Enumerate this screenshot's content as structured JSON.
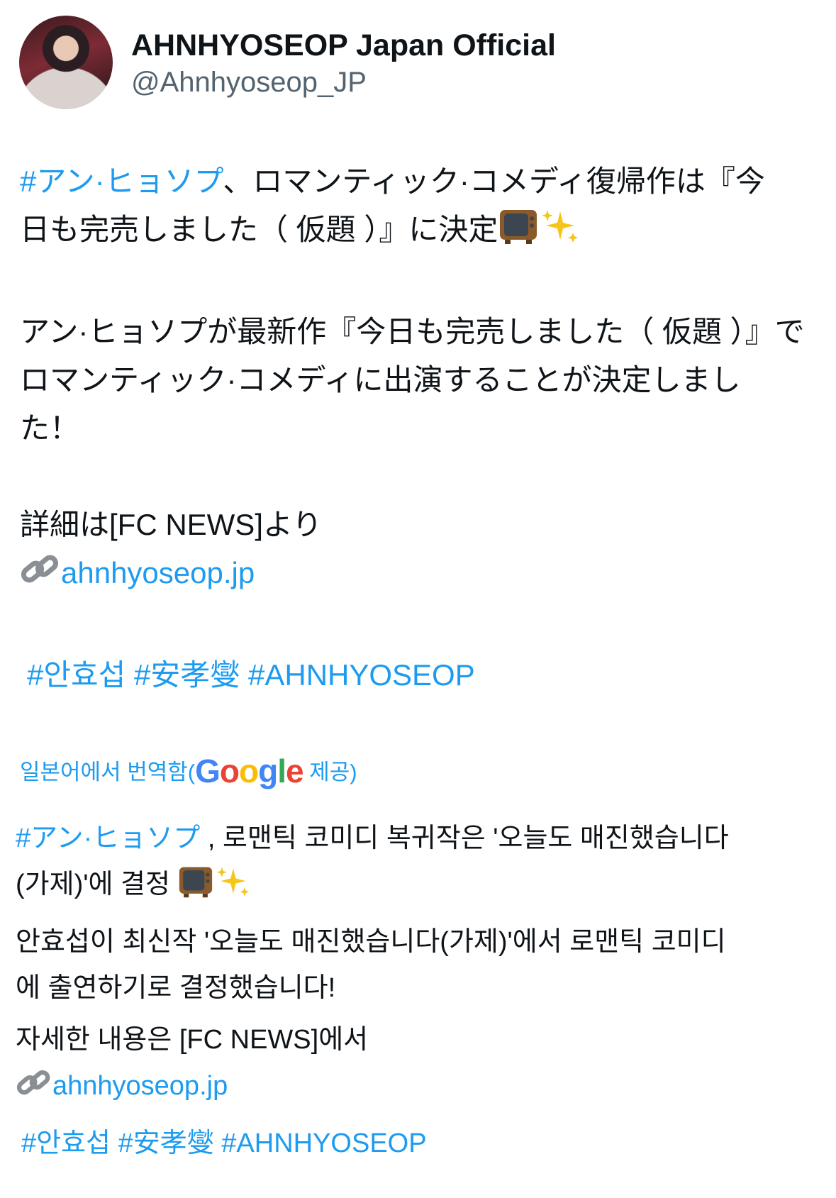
{
  "author": {
    "display_name": "AHNHYOSEOP Japan Official",
    "handle": "@Ahnhyoseop_JP",
    "avatar_icon": "profile-photo"
  },
  "original": {
    "hashtag_lead": "#アン·ヒョソプ",
    "line1_rest": "、ロマンティック·コメディ復帰作は『今",
    "line2": "日も完売しました（ 仮題 ）』に決定",
    "para2_line1": "アン·ヒョソプが最新作『今日も完売しました（ 仮題 ）』で",
    "para2_line2": "ロマンティック·コメディに出演することが決定しまし",
    "para2_line3": "た！",
    "details": "詳細は[FC NEWS]より",
    "link": "ahnhyoseop.jp",
    "tags": [
      "#안효섭",
      "#安孝燮",
      "#AHNHYOSEOP"
    ]
  },
  "translation_note": {
    "prefix": "일본어에서 번역함(",
    "google": [
      "G",
      "o",
      "o",
      "g",
      "l",
      "e"
    ],
    "suffix": " 제공)"
  },
  "translated": {
    "hashtag_lead": "#アン·ヒョソプ",
    "line1_rest": " , 로맨틱 코미디 복귀작은 '오늘도 매진했습니다",
    "line2": "(가제)'에 결정 ",
    "para2_line1": "안효섭이 최신작 '오늘도 매진했습니다(가제)'에서 로맨틱 코미디",
    "para2_line2": "에 출연하기로 결정했습니다!",
    "details": "자세한 내용은 [FC NEWS]에서",
    "link": "ahnhyoseop.jp",
    "tags": [
      "#안효섭",
      "#安孝燮",
      "#AHNHYOSEOP"
    ]
  },
  "icons": {
    "tv": "tv-icon",
    "sparkles": "sparkles-icon",
    "link": "link-icon"
  },
  "colors": {
    "link": "#1d9bf0",
    "text": "#0f1419",
    "secondary": "#536471"
  }
}
